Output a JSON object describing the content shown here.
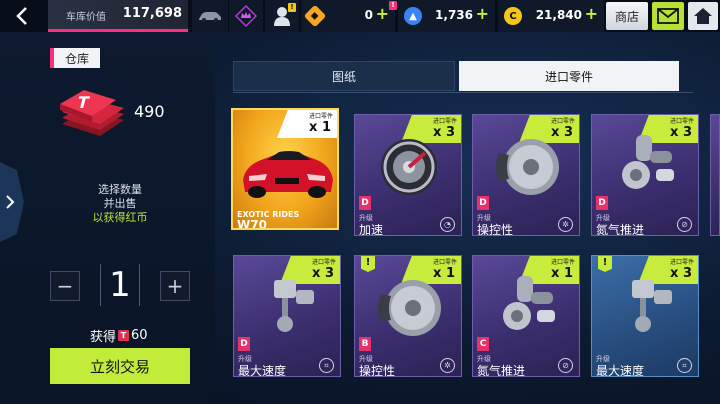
{
  "topbar": {
    "car_value_label": "车库价值",
    "car_value": "117,698",
    "currencies": [
      {
        "name": "gold-coin",
        "value": "0",
        "color": "#f6a623"
      },
      {
        "name": "blueprint-token",
        "value": "1,736",
        "color": "#3b82f6"
      },
      {
        "name": "credits",
        "value": "21,840",
        "color": "#f5c518"
      }
    ],
    "shop_label": "商店",
    "badge_text": "!"
  },
  "left": {
    "warehouse_label": "仓库",
    "token_count": "490",
    "instruction_line1": "选择数量",
    "instruction_line2": "并出售",
    "instruction_line3": "以获得红币",
    "quantity": "1",
    "minus": "−",
    "plus": "+",
    "earn_label": "获得",
    "earn_value": "60",
    "trade_button": "立刻交易"
  },
  "tabs": {
    "blueprint": "图纸",
    "imported_parts": "进口零件"
  },
  "cards": [
    {
      "type": "car",
      "brand": "EXOTIC RIDES",
      "name": "W70",
      "qty_label": "进口零件",
      "qty": "x 1"
    },
    {
      "type": "part",
      "part": "clutch",
      "grade": "D",
      "upgrade": "升级",
      "name": "加速",
      "qty_label": "进口零件",
      "qty": "x 3",
      "stat_icon": "speedometer-icon",
      "new": false,
      "color": "purple"
    },
    {
      "type": "part",
      "part": "brake",
      "grade": "D",
      "upgrade": "升级",
      "name": "操控性",
      "qty_label": "进口零件",
      "qty": "x 3",
      "stat_icon": "wheel-icon",
      "new": false,
      "color": "purple"
    },
    {
      "type": "part",
      "part": "turbo",
      "grade": "D",
      "upgrade": "升级",
      "name": "氮气推进",
      "qty_label": "进口零件",
      "qty": "x 3",
      "stat_icon": "nitro-icon",
      "new": false,
      "color": "purple"
    },
    {
      "type": "part",
      "part": "piston",
      "grade": "D",
      "upgrade": "升级",
      "name": "最大速度",
      "qty_label": "进口零件",
      "qty": "x 3",
      "stat_icon": "gearbox-icon",
      "new": false,
      "color": "purple"
    },
    {
      "type": "part",
      "part": "brake",
      "grade": "B",
      "upgrade": "升级",
      "name": "操控性",
      "qty_label": "进口零件",
      "qty": "x 1",
      "stat_icon": "wheel-icon",
      "new": true,
      "color": "purple"
    },
    {
      "type": "part",
      "part": "turbo",
      "grade": "C",
      "upgrade": "升级",
      "name": "氮气推进",
      "qty_label": "进口零件",
      "qty": "x 1",
      "stat_icon": "nitro-icon",
      "new": false,
      "color": "purple"
    },
    {
      "type": "part",
      "part": "piston",
      "grade": "",
      "upgrade": "升级",
      "name": "最大速度",
      "qty_label": "进口零件",
      "qty": "x 3",
      "stat_icon": "gearbox-icon",
      "new": true,
      "color": "blue"
    }
  ]
}
